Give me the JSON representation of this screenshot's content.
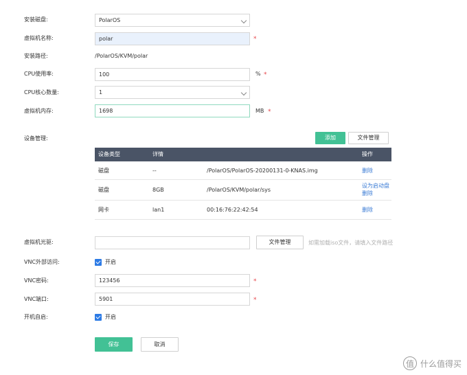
{
  "form": {
    "disk": {
      "label": "安装磁盘:",
      "value": "PolarOS"
    },
    "vm_name": {
      "label": "虚拟机名称:",
      "value": "polar"
    },
    "install_path": {
      "label": "安装路径:",
      "value": "/PolarOS/KVM/polar"
    },
    "cpu_usage": {
      "label": "CPU使用率:",
      "value": "100",
      "unit": "%"
    },
    "cpu_cores": {
      "label": "CPU核心数量:",
      "value": "1"
    },
    "memory": {
      "label": "虚拟机内存:",
      "value": "1698",
      "unit": "MB"
    },
    "required_mark": "*"
  },
  "devices": {
    "label": "设备管理:",
    "add_button": "添加",
    "file_manager_button": "文件管理",
    "columns": [
      "设备类型",
      "详情",
      "",
      "操作"
    ],
    "rows": [
      {
        "type": "磁盘",
        "detail": "--",
        "path": "/PolarOS/PolarOS-20200131-0-KNAS.img",
        "actions": [
          "删除"
        ]
      },
      {
        "type": "磁盘",
        "detail": "8GB",
        "path": "/PolarOS/KVM/polar/sys",
        "actions": [
          "设为启动盘",
          "删除"
        ]
      },
      {
        "type": "网卡",
        "detail": "lan1",
        "path": "00:16:76:22:42:54",
        "actions": [
          "删除"
        ]
      }
    ]
  },
  "cdrom": {
    "label": "虚拟机光驱:",
    "value": "",
    "file_manager_button": "文件管理",
    "hint": "如需加载iso文件，请填入文件路径"
  },
  "vnc_access": {
    "label": "VNC外部访问:",
    "option": "开启",
    "checked": true
  },
  "vnc_password": {
    "label": "VNC密码:",
    "value": "123456"
  },
  "vnc_port": {
    "label": "VNC端口:",
    "value": "5901"
  },
  "autostart": {
    "label": "开机自启:",
    "option": "开启",
    "checked": true
  },
  "actions": {
    "save": "保存",
    "cancel": "取消"
  },
  "watermark": {
    "icon_text": "值",
    "text": "什么值得买"
  },
  "colors": {
    "accent": "#42c195",
    "table_header": "#4a5466",
    "link": "#3a7bd5",
    "required": "#e6454a",
    "checkbox": "#2d7be5"
  }
}
